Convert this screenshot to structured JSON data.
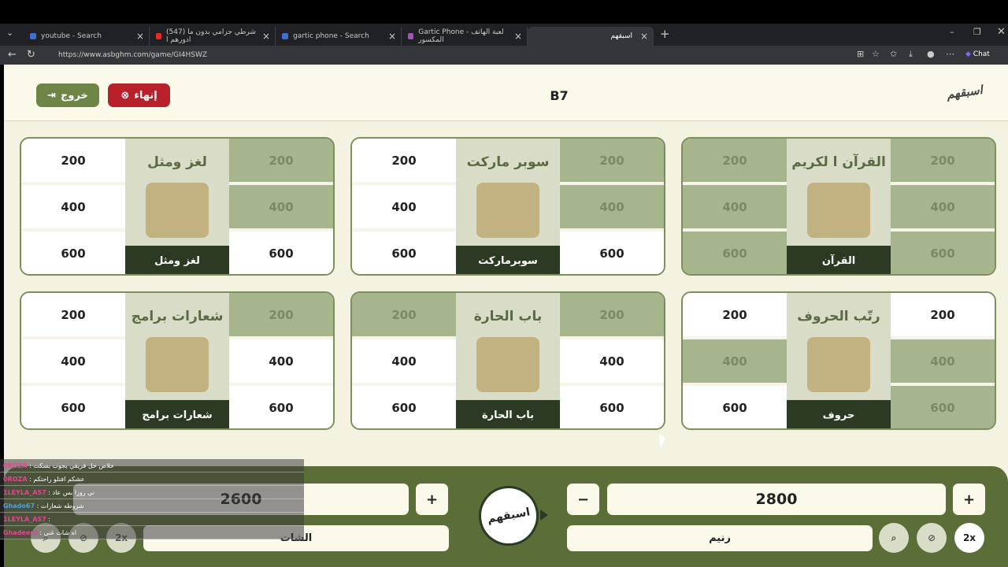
{
  "browser": {
    "tabs": [
      {
        "label": "youtube - Search",
        "color": "#3b6fd4"
      },
      {
        "label": "(547) شرطي جزامي بدون ما ادورهم ا",
        "color": "#e52d27"
      },
      {
        "label": "gartic phone - Search",
        "color": "#3b6fd4"
      },
      {
        "label": "Gartic Phone - لعبة الهاتف المكسور",
        "color": "#9b59b6"
      },
      {
        "label": "اسبقهم",
        "color": "#6f8545"
      }
    ],
    "url": "https://www.asbghm.com/game/GI4HSWZ",
    "chat_label": "Chat"
  },
  "header": {
    "exit_label": "خروج",
    "end_label": "إنهاء",
    "room_code": "B7",
    "logo_text": "اسبقهم"
  },
  "cards": [
    {
      "name": "quran",
      "title": "القرآن ا لكريم",
      "label": "القرآن",
      "left": [
        "200",
        "400",
        "600"
      ],
      "right": [
        "200",
        "400",
        "600"
      ],
      "left_on": [
        false,
        false,
        false
      ],
      "right_on": [
        false,
        false,
        false
      ]
    },
    {
      "name": "supermarket",
      "title": "سوبر ماركت",
      "label": "سوبرماركت",
      "left": [
        "200",
        "400",
        "600"
      ],
      "right": [
        "200",
        "400",
        "600"
      ],
      "left_on": [
        true,
        true,
        true
      ],
      "right_on": [
        false,
        false,
        true
      ]
    },
    {
      "name": "riddle",
      "title": "لغز ومثل",
      "label": "لغز ومثل",
      "left": [
        "200",
        "400",
        "600"
      ],
      "right": [
        "200",
        "400",
        "600"
      ],
      "left_on": [
        true,
        true,
        true
      ],
      "right_on": [
        false,
        false,
        true
      ]
    },
    {
      "name": "letters",
      "title": "رتّب الحروف",
      "label": "حروف",
      "left": [
        "200",
        "400",
        "600"
      ],
      "right": [
        "200",
        "400",
        "600"
      ],
      "left_on": [
        true,
        false,
        true
      ],
      "right_on": [
        true,
        false,
        false
      ]
    },
    {
      "name": "hara",
      "title": "باب الحارة",
      "label": "باب الحارة",
      "left": [
        "200",
        "400",
        "600"
      ],
      "right": [
        "200",
        "400",
        "600"
      ],
      "left_on": [
        false,
        true,
        true
      ],
      "right_on": [
        false,
        true,
        true
      ]
    },
    {
      "name": "apps",
      "title": "شعارات برامج",
      "label": "شعارات برامج",
      "left": [
        "200",
        "400",
        "600"
      ],
      "right": [
        "200",
        "400",
        "600"
      ],
      "left_on": [
        true,
        true,
        true
      ],
      "right_on": [
        false,
        true,
        true
      ]
    }
  ],
  "teams": {
    "left": {
      "score": "2600",
      "name": "الشات",
      "plus": "+",
      "double": "2x"
    },
    "right": {
      "score": "2800",
      "name": "رنيم",
      "plus": "+",
      "minus": "−",
      "double": "2x"
    }
  },
  "chat": [
    {
      "nick": "0ROZA",
      "msg": ": خلاص خل فريقي يجوب بسكت",
      "color": "#e84393"
    },
    {
      "nick": "0ROZA",
      "msg": ": عشكم افتلو راحتكم",
      "color": "#e84393"
    },
    {
      "nick": "1LEYLA_AS7",
      "msg": ": ني روزا بس عاد",
      "color": "#e84393"
    },
    {
      "nick": "Ghado67",
      "msg": ": شروطه شعارات",
      "color": "#4aa3df"
    },
    {
      "nick": "1LEYLA_AS7",
      "msg": ":",
      "color": "#e84393"
    },
    {
      "nick": "Ghadeer0",
      "msg": ": اه شات غني",
      "color": "#e84393"
    }
  ]
}
